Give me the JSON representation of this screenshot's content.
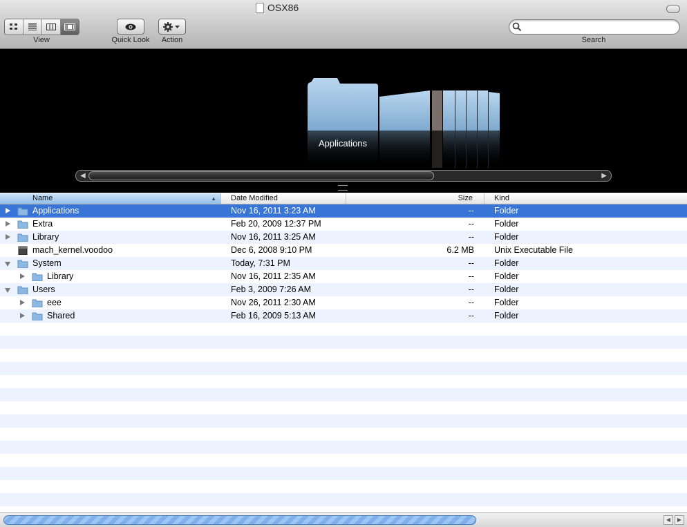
{
  "window": {
    "title": "OSX86"
  },
  "toolbar": {
    "view_label": "View",
    "quicklook_label": "Quick Look",
    "action_label": "Action",
    "search_label": "Search",
    "search_value": "",
    "view_buttons": [
      "icon-view-icon",
      "list-view-icon",
      "column-view-icon",
      "coverflow-view-icon"
    ],
    "selected_view": "coverflow"
  },
  "coverflow": {
    "selected_label": "Applications"
  },
  "columns": {
    "name": "Name",
    "date": "Date Modified",
    "size": "Size",
    "kind": "Kind"
  },
  "files": [
    {
      "name": "Applications",
      "date": "Nov 16, 2011 3:23 AM",
      "size": "--",
      "kind": "Folder"
    },
    {
      "name": "Extra",
      "date": "Feb 20, 2009 12:37 PM",
      "size": "--",
      "kind": "Folder"
    },
    {
      "name": "Library",
      "date": "Nov 16, 2011 3:25 AM",
      "size": "--",
      "kind": "Folder"
    },
    {
      "name": "mach_kernel.voodoo",
      "date": "Dec 6, 2008 9:10 PM",
      "size": "6.2 MB",
      "kind": "Unix Executable File"
    },
    {
      "name": "System",
      "date": "Today, 7:31 PM",
      "size": "--",
      "kind": "Folder"
    },
    {
      "name": "Library",
      "date": "Nov 16, 2011 2:35 AM",
      "size": "--",
      "kind": "Folder"
    },
    {
      "name": "Users",
      "date": "Feb 3, 2009 7:26 AM",
      "size": "--",
      "kind": "Folder"
    },
    {
      "name": "eee",
      "date": "Nov 26, 2011 2:30 AM",
      "size": "--",
      "kind": "Folder"
    },
    {
      "name": "Shared",
      "date": "Feb 16, 2009 5:13 AM",
      "size": "--",
      "kind": "Folder"
    }
  ],
  "colors": {
    "selection": "#3875d7",
    "alt_row": "#edf3fe",
    "header_sorted": "#93bfe8"
  }
}
